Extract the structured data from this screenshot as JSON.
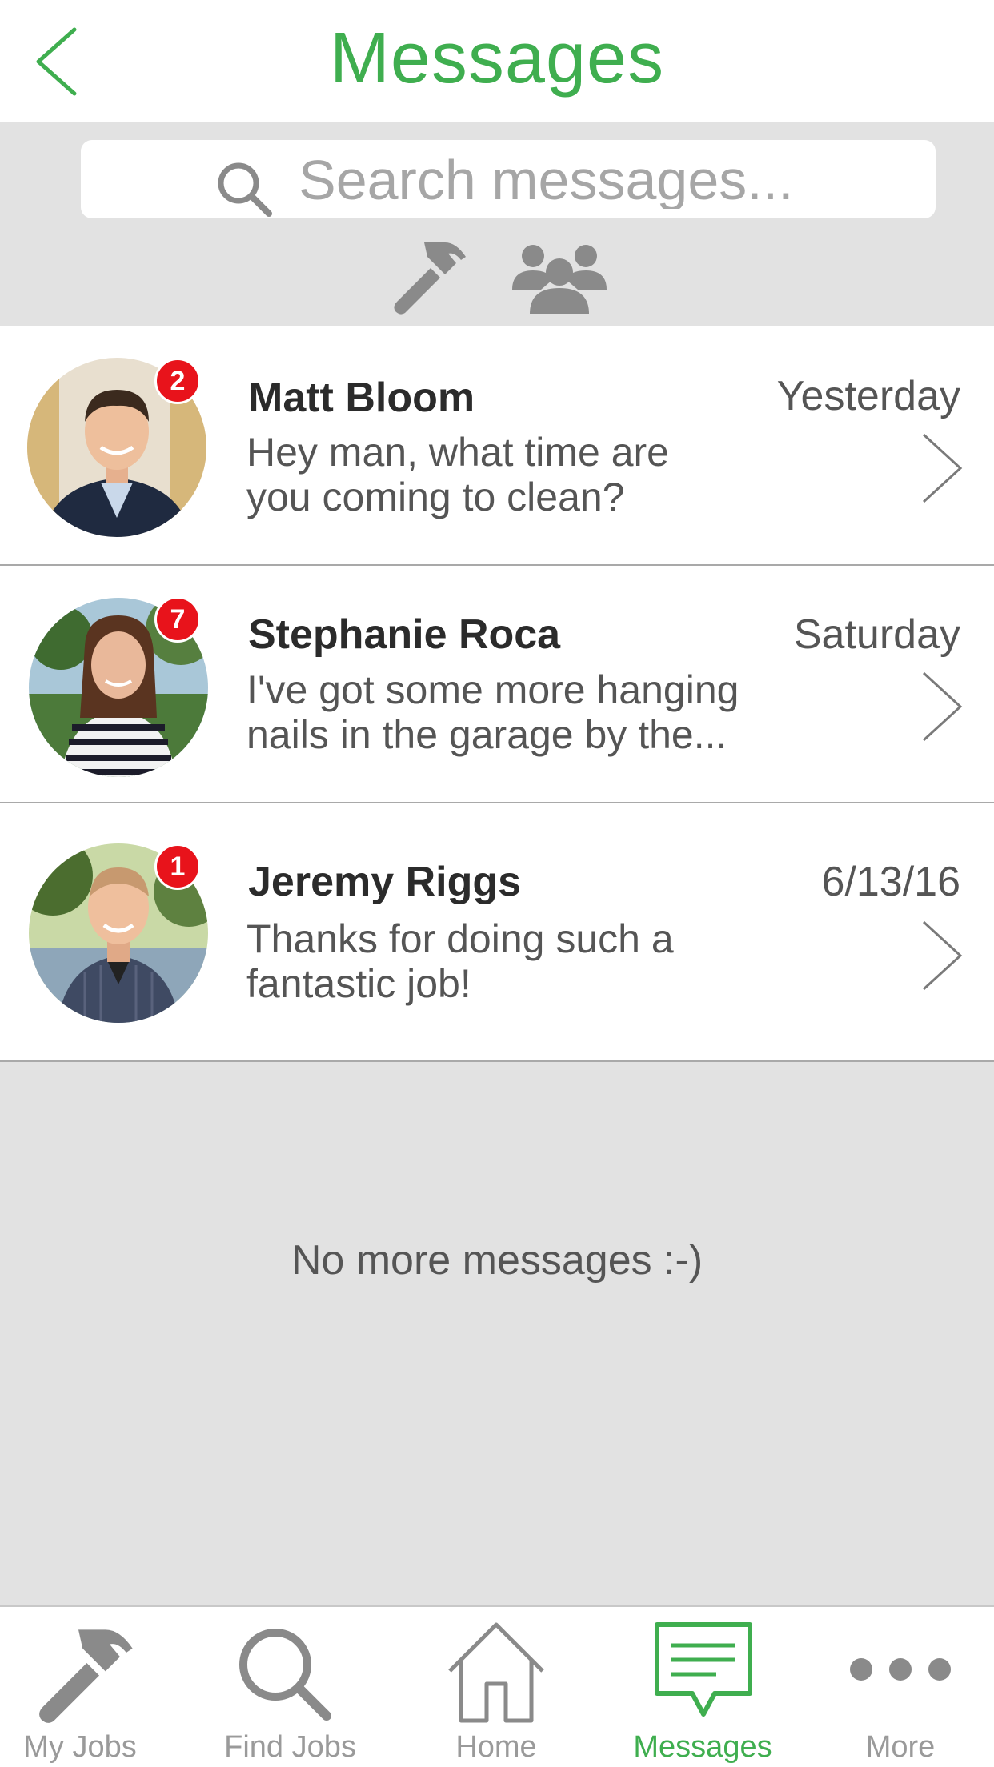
{
  "header": {
    "title": "Messages",
    "back_icon": "chevron-left-icon",
    "accent_color": "#3fae4f"
  },
  "search": {
    "placeholder": "Search messages...",
    "value": "",
    "icon": "search-icon"
  },
  "filters": [
    {
      "icon": "hammer-icon"
    },
    {
      "icon": "group-icon"
    }
  ],
  "conversations": [
    {
      "name": "Matt Bloom",
      "date": "Yesterday",
      "preview_line1": "Hey man, what time are",
      "preview_line2": "you coming to clean?",
      "unread": "2"
    },
    {
      "name": "Stephanie Roca",
      "date": "Saturday",
      "preview_line1": "I've got some more hanging",
      "preview_line2": "nails in the garage by the...",
      "unread": "7"
    },
    {
      "name": "Jeremy Riggs",
      "date": "6/13/16",
      "preview_line1": "Thanks for doing such a",
      "preview_line2": "fantastic job!",
      "unread": "1"
    }
  ],
  "empty_message": "No more messages :-)",
  "tabbar": {
    "items": [
      {
        "label": "My Jobs",
        "icon": "hammer-icon"
      },
      {
        "label": "Find Jobs",
        "icon": "search-icon"
      },
      {
        "label": "Home",
        "icon": "home-icon"
      },
      {
        "label": "Messages",
        "icon": "message-icon",
        "active": true
      },
      {
        "label": "More",
        "icon": "more-icon"
      }
    ]
  },
  "colors": {
    "badge": "#e8131b",
    "inactive": "#9a9a9a",
    "background_gray": "#e2e2e2"
  }
}
